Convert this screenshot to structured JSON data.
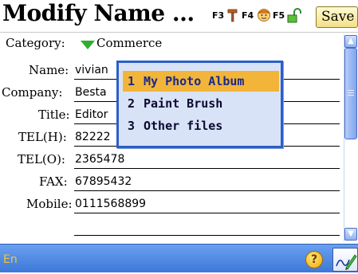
{
  "title": "Modify Name ...",
  "fkeys": {
    "f3": "F3",
    "f4": "F4",
    "f5": "F5"
  },
  "save_label": "Save",
  "category": {
    "label": "Category:",
    "value": "Commerce"
  },
  "fields": [
    {
      "label": "Name:",
      "value": "vivian"
    },
    {
      "label": "Company:",
      "value": "Besta"
    },
    {
      "label": "Title:",
      "value": "Editor"
    },
    {
      "label": "TEL(H):",
      "value": "82222"
    },
    {
      "label": "TEL(O):",
      "value": "2365478"
    },
    {
      "label": "FAX:",
      "value": "67895432"
    },
    {
      "label": "Mobile:",
      "value": "0111568899"
    }
  ],
  "popup_menu": {
    "items": [
      {
        "num": "1",
        "label": "My Photo Album",
        "selected": true
      },
      {
        "num": "2",
        "label": "Paint Brush",
        "selected": false
      },
      {
        "num": "3",
        "label": "Other files",
        "selected": false
      }
    ]
  },
  "status": {
    "language": "En",
    "help": "?"
  },
  "colors": {
    "popup_border": "#2a5fc8",
    "popup_bg": "#d9e3f7",
    "selected_bg": "#f2b53a",
    "bottom_bar": "#4a86e0",
    "category_arrow": "#2fae2f"
  },
  "icons": {
    "f3": "hammer-icon",
    "f4": "face-icon",
    "f5": "unlock-icon",
    "scroll_up": "arrow-up-icon",
    "scroll_down": "arrow-down-icon",
    "help": "help-icon",
    "handwriting": "pen-icon"
  }
}
